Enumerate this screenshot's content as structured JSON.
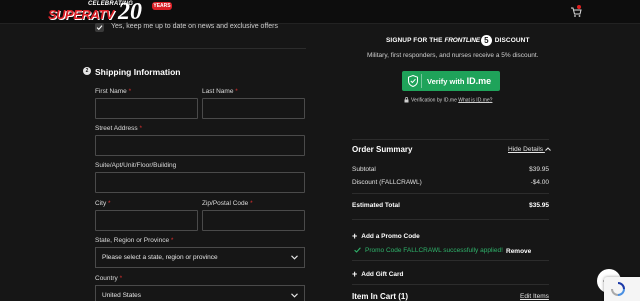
{
  "header": {
    "logo_celebrating": "CELEBRATING",
    "logo_brand": "SUPERATV",
    "logo_number": "20",
    "logo_years": "YEARS",
    "colors": {
      "brand_red": "#d91f26",
      "header_bg": "#0d0d0d"
    }
  },
  "newsletter": {
    "checked": true,
    "label": "Yes, keep me up to date on news and exclusive offers"
  },
  "shipping": {
    "step": "2",
    "title": "Shipping Information",
    "first_name_label": "First Name",
    "last_name_label": "Last Name",
    "street_label": "Street Address",
    "suite_label": "Suite/Apt/Unit/Floor/Building",
    "city_label": "City",
    "zip_label": "Zip/Postal Code",
    "state_label": "State, Region or Province",
    "state_value": "Please select a state, region or province",
    "country_label": "Country",
    "country_value": "United States",
    "required_mark": "*"
  },
  "signup": {
    "heading_prefix": "SIGNUP FOR THE",
    "heading_frontline": "FRONTLINE",
    "heading_five": "5",
    "heading_suffix": "DISCOUNT",
    "subtext": "Military, first responders, and nurses receive a 5% discount.",
    "button_prefix": "Verify with",
    "button_brand": "ID.me",
    "verification_text": "Verification by ID.me",
    "what_is_link": "What is ID.me?",
    "button_color": "#1fa35a"
  },
  "order_summary": {
    "title": "Order Summary",
    "hide_details": "Hide Details",
    "rows": [
      {
        "label": "Subtotal",
        "value": "$39.95"
      },
      {
        "label": "Discount (FALLCRAWL)",
        "value": "-$4.00"
      }
    ],
    "total_label": "Estimated Total",
    "total_value": "$35.95",
    "promo_add": "Add a Promo Code",
    "promo_success": "Promo Code FALLCRAWL successfully applied!",
    "remove_label": "Remove",
    "gift_add": "Add Gift Card",
    "items_title": "Item In Cart (1)",
    "edit_items": "Edit Items",
    "success_color": "#2fb36b"
  }
}
